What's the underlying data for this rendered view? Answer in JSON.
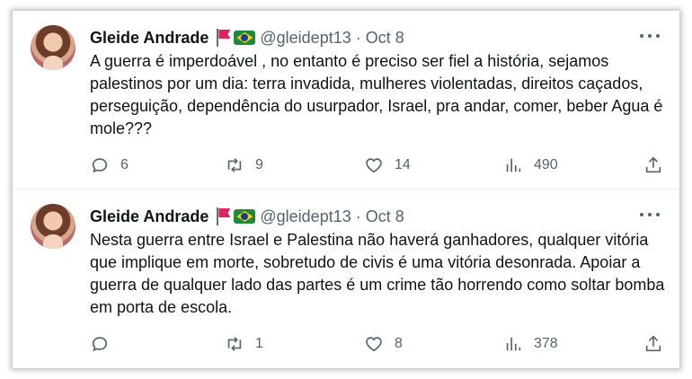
{
  "tweets": [
    {
      "author": {
        "name": "Gleide Andrade",
        "handle": "@gleidept13",
        "badges": [
          "red-flag-icon",
          "brazil-flag-icon"
        ]
      },
      "separator": "·",
      "date": "Oct 8",
      "text": "A guerra é imperdoável , no entanto é preciso ser fiel a história, sejamos palestinos por um dia: terra invadida, mulheres violentadas, direitos caçados, perseguição,  dependência do usurpador, Israel, pra andar, comer, beber Agua é mole???",
      "stats": {
        "replies": "6",
        "retweets": "9",
        "likes": "14",
        "views": "490"
      }
    },
    {
      "author": {
        "name": "Gleide Andrade",
        "handle": "@gleidept13",
        "badges": [
          "red-flag-icon",
          "brazil-flag-icon"
        ]
      },
      "separator": "·",
      "date": "Oct 8",
      "text": "Nesta guerra entre Israel e Palestina não haverá ganhadores, qualquer vitória que implique em morte, sobretudo de civis é uma vitória desonrada. Apoiar a guerra de qualquer lado das partes é um crime tão horrendo como soltar bomba em porta de escola.",
      "stats": {
        "replies": "",
        "retweets": "1",
        "likes": "8",
        "views": "378"
      }
    }
  ],
  "colors": {
    "text": "#0f1419",
    "muted": "#536471",
    "divider": "#e6ecf0"
  }
}
